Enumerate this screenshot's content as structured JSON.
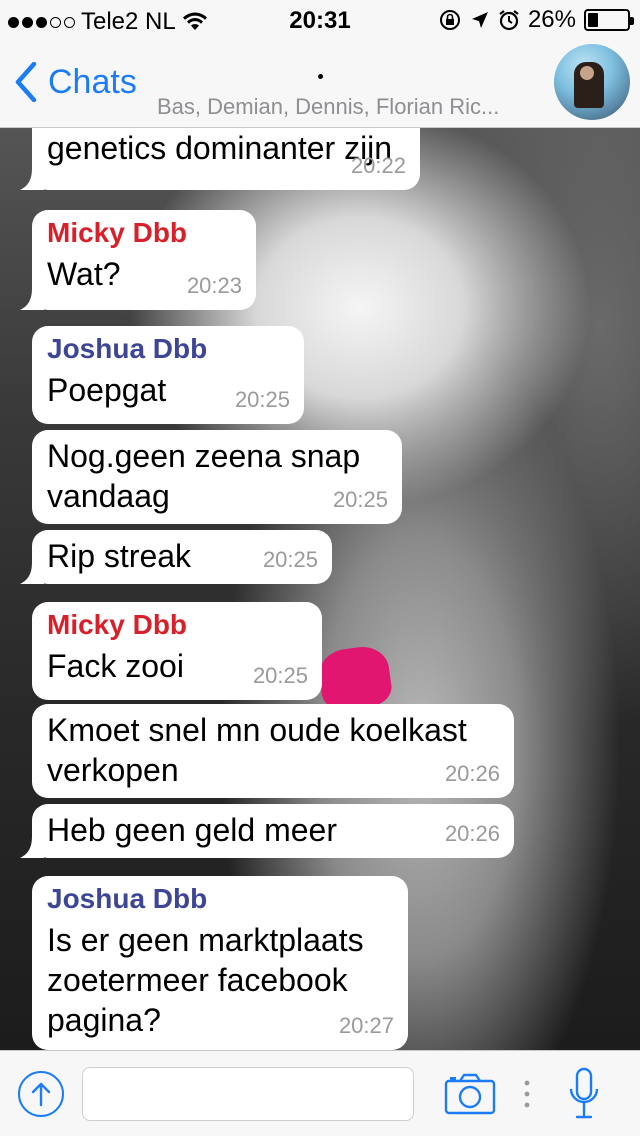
{
  "status_bar": {
    "carrier": "Tele2 NL",
    "time": "20:31",
    "battery": "26%",
    "battery_level": 0.26,
    "signal_bars_filled": 3,
    "signal_bars_total": 5
  },
  "nav": {
    "back_label": "Chats",
    "title": "•",
    "subtitle": "Bas, Demian, Dennis, Florian Ric..."
  },
  "messages": [
    {
      "sender": "",
      "text": "genetics dominanter zijn",
      "time": "20:22",
      "sender_color": ""
    },
    {
      "sender": "Micky Dbb",
      "text": "Wat?",
      "time": "20:23",
      "sender_color": "#d8202a"
    },
    {
      "sender": "Joshua Dbb",
      "text": "Poepgat",
      "time": "20:25",
      "sender_color": "#3d4696"
    },
    {
      "sender": "",
      "text": "Nog.geen zeena snap vandaag",
      "time": "20:25",
      "sender_color": ""
    },
    {
      "sender": "",
      "text": "Rip streak",
      "time": "20:25",
      "sender_color": ""
    },
    {
      "sender": "Micky Dbb",
      "text": "Fack zooi",
      "time": "20:25",
      "sender_color": "#d8202a"
    },
    {
      "sender": "",
      "text": "Kmoet snel mn oude koelkast verkopen",
      "time": "20:26",
      "sender_color": ""
    },
    {
      "sender": "",
      "text": "Heb geen geld meer",
      "time": "20:26",
      "sender_color": ""
    },
    {
      "sender": "Joshua Dbb",
      "text": "Is er geen marktplaats zoetermeer facebook pagina?",
      "time": "20:27",
      "sender_color": "#3d4696"
    }
  ],
  "input": {
    "placeholder": ""
  },
  "colors": {
    "accent": "#1b7cf6"
  }
}
